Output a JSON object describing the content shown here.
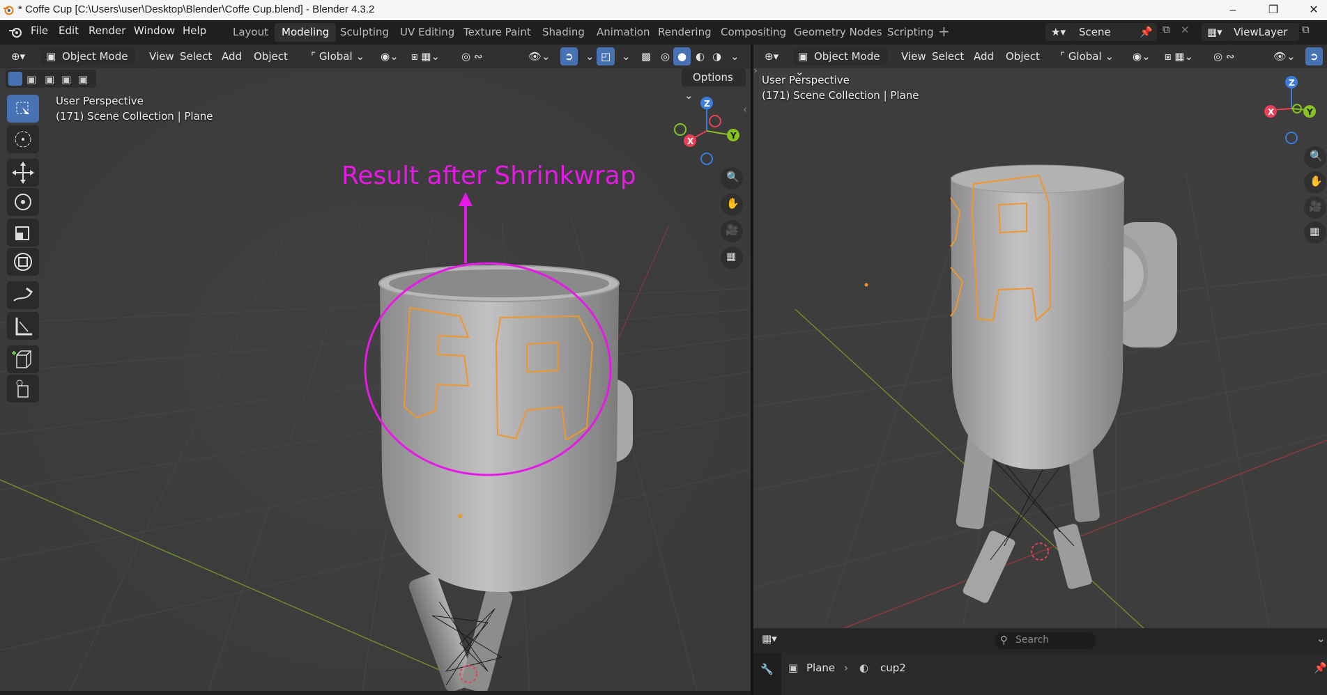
{
  "window": {
    "title": "* Coffe Cup [C:\\Users\\user\\Desktop\\Blender\\Coffe Cup.blend] - Blender 4.3.2",
    "minimize_icon": "minimize-icon",
    "maximize_icon": "restore-icon",
    "close_icon": "close-icon"
  },
  "menu": [
    "File",
    "Edit",
    "Render",
    "Window",
    "Help"
  ],
  "workspaces": [
    "Layout",
    "Modeling",
    "Sculpting",
    "UV Editing",
    "Texture Paint",
    "Shading",
    "Animation",
    "Rendering",
    "Compositing",
    "Geometry Nodes",
    "Scripting"
  ],
  "active_workspace": "Modeling",
  "scene": {
    "label": "Scene",
    "view_layer": "ViewLayer"
  },
  "viewport_left": {
    "mode": "Object Mode",
    "menus": [
      "View",
      "Select",
      "Add",
      "Object"
    ],
    "orientation": "Global",
    "options_label": "Options",
    "perspective": "User Perspective",
    "collection": "(171) Scene Collection | Plane",
    "annotation": "Result after Shrinkwrap",
    "annotation_color": "#e619e6",
    "letters": "FA",
    "gizmo": {
      "x": "X",
      "y": "Y",
      "z": "Z"
    }
  },
  "viewport_right": {
    "mode": "Object Mode",
    "menus": [
      "View",
      "Select",
      "Add",
      "Object"
    ],
    "orientation": "Global",
    "perspective": "User Perspective",
    "collection": "(171) Scene Collection | Plane",
    "gizmo": {
      "x": "X",
      "y": "Y",
      "z": "Z"
    }
  },
  "properties": {
    "search_placeholder": "Search",
    "breadcrumb_object": "Plane",
    "breadcrumb_mesh": "cup2"
  },
  "colors": {
    "x_axis": "#e84155",
    "y_axis": "#86c221",
    "z_axis": "#3b7ddc",
    "selection_outline": "#f0962c",
    "active_tool": "#4772b3"
  }
}
